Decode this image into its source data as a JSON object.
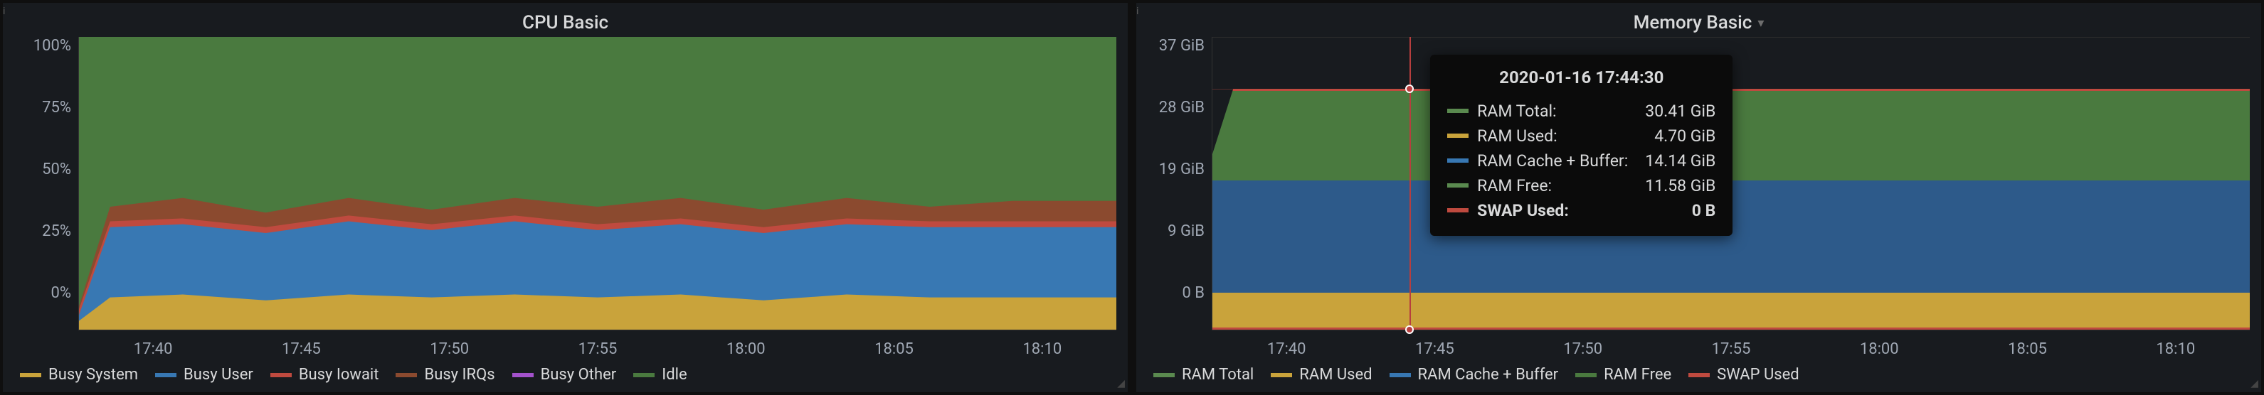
{
  "panels": {
    "cpu": {
      "title": "CPU Basic",
      "yticks": [
        "100%",
        "75%",
        "50%",
        "25%",
        "0%"
      ],
      "xticks": [
        "17:40",
        "17:45",
        "17:50",
        "17:55",
        "18:00",
        "18:05",
        "18:10"
      ],
      "legend": [
        {
          "label": "Busy System",
          "color": "#c9a33b"
        },
        {
          "label": "Busy User",
          "color": "#3878b3"
        },
        {
          "label": "Busy Iowait",
          "color": "#bf4a3f"
        },
        {
          "label": "Busy IRQs",
          "color": "#8b4a2f"
        },
        {
          "label": "Busy Other",
          "color": "#a352cc"
        },
        {
          "label": "Idle",
          "color": "#4a7a3f"
        }
      ]
    },
    "memory": {
      "title": "Memory Basic",
      "yticks": [
        "37 GiB",
        "28 GiB",
        "19 GiB",
        "9 GiB",
        "0 B"
      ],
      "xticks": [
        "17:40",
        "17:45",
        "17:50",
        "17:55",
        "18:00",
        "18:05",
        "18:10"
      ],
      "legend": [
        {
          "label": "RAM Total",
          "color": "#5a8a4f"
        },
        {
          "label": "RAM Used",
          "color": "#c9a33b"
        },
        {
          "label": "RAM Cache + Buffer",
          "color": "#3878b3"
        },
        {
          "label": "RAM Free",
          "color": "#4a7a3f"
        },
        {
          "label": "SWAP Used",
          "color": "#bf4a3f"
        }
      ],
      "tooltip": {
        "timestamp": "2020-01-16 17:44:30",
        "rows": [
          {
            "label": "RAM Total:",
            "value": "30.41 GiB",
            "color": "#5a8a4f",
            "bold": false
          },
          {
            "label": "RAM Used:",
            "value": "4.70 GiB",
            "color": "#c9a33b",
            "bold": false
          },
          {
            "label": "RAM Cache + Buffer:",
            "value": "14.14 GiB",
            "color": "#3878b3",
            "bold": false
          },
          {
            "label": "RAM Free:",
            "value": "11.58 GiB",
            "color": "#5a8a4f",
            "bold": false
          },
          {
            "label": "SWAP Used:",
            "value": "0 B",
            "color": "#bf4a3f",
            "bold": true
          }
        ]
      }
    }
  },
  "chart_data": [
    {
      "type": "area",
      "title": "CPU Basic",
      "xlabel": "",
      "ylabel": "",
      "ylim": [
        0,
        100
      ],
      "x": [
        "17:38",
        "17:40",
        "17:45",
        "17:50",
        "17:55",
        "18:00",
        "18:05",
        "18:10"
      ],
      "series": [
        {
          "name": "Busy System",
          "values": [
            3,
            10,
            11,
            10,
            11,
            10,
            11,
            11
          ]
        },
        {
          "name": "Busy User",
          "values": [
            5,
            25,
            25,
            24,
            25,
            25,
            25,
            25
          ]
        },
        {
          "name": "Busy Iowait",
          "values": [
            0,
            2,
            2,
            2,
            2,
            2,
            2,
            2
          ]
        },
        {
          "name": "Busy IRQs",
          "values": [
            0,
            5,
            7,
            6,
            7,
            5,
            6,
            6
          ]
        },
        {
          "name": "Busy Other",
          "values": [
            0,
            0,
            0,
            0,
            0,
            0,
            0,
            0
          ]
        },
        {
          "name": "Idle",
          "values": [
            92,
            58,
            55,
            58,
            55,
            58,
            56,
            56
          ]
        }
      ],
      "stacked": true,
      "unit": "%"
    },
    {
      "type": "area",
      "title": "Memory Basic",
      "xlabel": "",
      "ylabel": "",
      "ylim": [
        0,
        37
      ],
      "x": [
        "17:38",
        "17:40",
        "17:45",
        "17:50",
        "17:55",
        "18:00",
        "18:05",
        "18:10"
      ],
      "series": [
        {
          "name": "RAM Used",
          "values": [
            4.7,
            4.7,
            4.7,
            4.7,
            4.7,
            4.7,
            4.7,
            4.7
          ]
        },
        {
          "name": "RAM Cache + Buffer",
          "values": [
            14.1,
            14.1,
            14.1,
            14.1,
            14.1,
            14.1,
            14.1,
            14.1
          ]
        },
        {
          "name": "RAM Free",
          "values": [
            11.6,
            11.6,
            11.6,
            11.6,
            11.6,
            11.6,
            11.6,
            11.6
          ]
        }
      ],
      "lines": [
        {
          "name": "RAM Total",
          "value": 30.41
        },
        {
          "name": "SWAP Used",
          "value": 0
        }
      ],
      "stacked": true,
      "unit": "GiB",
      "hover": {
        "x": "17:44:30",
        "RAM Total": 30.41,
        "RAM Used": 4.7,
        "RAM Cache + Buffer": 14.14,
        "RAM Free": 11.58,
        "SWAP Used": 0
      }
    }
  ]
}
